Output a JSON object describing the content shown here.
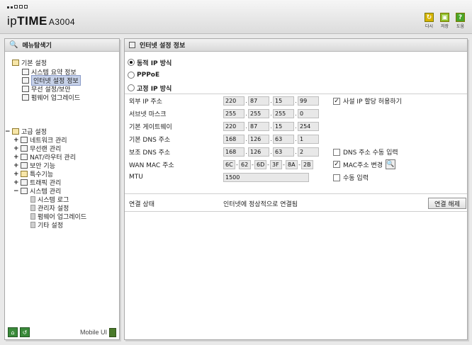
{
  "header": {
    "brand_ip": "ip",
    "brand_time": "TIME",
    "model": "A3004",
    "buttons": [
      {
        "label": "다시",
        "icon": "refresh-icon",
        "color": "#d8b400"
      },
      {
        "label": "저장",
        "icon": "save-icon",
        "color": "#8fbf2a"
      },
      {
        "label": "도움",
        "icon": "help-icon",
        "color": "#4aa52a"
      }
    ]
  },
  "sidebar": {
    "title": "메뉴탐색기",
    "basic": {
      "label": "기본 설정",
      "items": [
        "시스템 요약 정보",
        "인터넷 설정 정보",
        "무선 설정/보안",
        "펌웨어 업그레이드"
      ]
    },
    "advanced": {
      "label": "고급 설정",
      "items": [
        "네트워크 관리",
        "무선랜 관리",
        "NAT/라우터 관리",
        "보안 기능",
        "특수기능",
        "트래픽 관리",
        "시스템 관리"
      ],
      "system_sub": [
        "시스템 로그",
        "관리자 설정",
        "펌웨어 업그레이드",
        "기타 설정"
      ]
    },
    "mobile_label": "Mobile UI"
  },
  "main": {
    "title": "인터넷 설정 정보",
    "radios": [
      "동적 IP 방식",
      "PPPoE",
      "고정 IP 방식"
    ],
    "selected_radio": "동적 IP 방식",
    "fields": {
      "external_ip": {
        "label": "외부 IP 주소",
        "octets": [
          "220",
          "87",
          "15",
          "99"
        ]
      },
      "subnet_mask": {
        "label": "서브넷 마스크",
        "octets": [
          "255",
          "255",
          "255",
          "0"
        ]
      },
      "gateway": {
        "label": "기본 게이트웨이",
        "octets": [
          "220",
          "87",
          "15",
          "254"
        ]
      },
      "dns1": {
        "label": "기본 DNS 주소",
        "octets": [
          "168",
          "126",
          "63",
          "1"
        ]
      },
      "dns2": {
        "label": "보조 DNS 주소",
        "octets": [
          "168",
          "126",
          "63",
          "2"
        ]
      },
      "wan_mac": {
        "label": "WAN MAC 주소",
        "octets": [
          "6C",
          "62",
          "6D",
          "3F",
          "8A",
          "2B"
        ]
      },
      "mtu": {
        "label": "MTU",
        "value": "1500"
      }
    },
    "checks": {
      "private_ip": {
        "label": "사설 IP 할당 허용하기",
        "checked": true
      },
      "dns_manual": {
        "label": "DNS 주소 수동 입력",
        "checked": false
      },
      "mac_change": {
        "label": "MAC주소 변경",
        "checked": true
      },
      "mtu_manual": {
        "label": "수동 입력",
        "checked": false
      }
    },
    "status": {
      "label": "연결 상태",
      "value": "인터넷에 정상적으로 연결됨",
      "button": "연결 해제"
    }
  }
}
